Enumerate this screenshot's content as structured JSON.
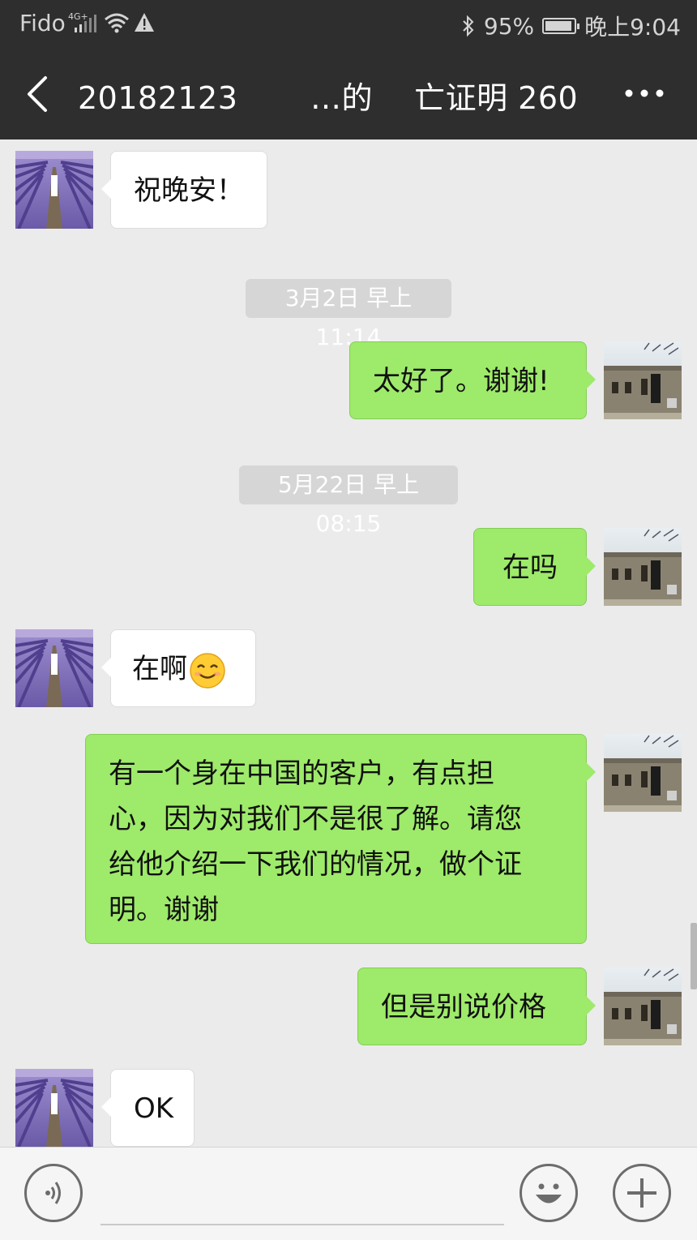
{
  "status_bar": {
    "carrier": "Fido",
    "network": "4G+",
    "battery_percent": "95%",
    "battery_level": 0.95,
    "time": "晚上9:04"
  },
  "header": {
    "title": "20182123    …的  亡证明 260"
  },
  "messages": [
    {
      "side": "in",
      "text": "祝晚安！"
    },
    {
      "type": "timestamp",
      "text": "3月2日 早上11:14"
    },
    {
      "side": "out",
      "text": "太好了。谢谢!"
    },
    {
      "type": "timestamp",
      "text": "5月22日 早上08:15"
    },
    {
      "side": "out",
      "text": "在吗"
    },
    {
      "side": "in",
      "text": "在啊",
      "emoji": "smiling-face-emoji"
    },
    {
      "side": "out",
      "lines": [
        "有一个身在中国的客户，有点担",
        "心，因为对我们不是很了解。请您",
        "给他介绍一下我们的情况，做个证",
        "明。谢谢"
      ]
    },
    {
      "side": "out",
      "text": "但是别说价格"
    },
    {
      "side": "in",
      "text": "OK"
    }
  ],
  "icons": {
    "back": "back-arrow-icon",
    "more": "more-dots-icon",
    "voice": "voice-icon",
    "emoji": "emoji-icon",
    "plus": "plus-icon"
  },
  "colors": {
    "bar": "#2e2e2e",
    "outgoing_bubble": "#9eea6a",
    "incoming_bubble": "#ffffff",
    "chat_background": "#ebebeb"
  }
}
